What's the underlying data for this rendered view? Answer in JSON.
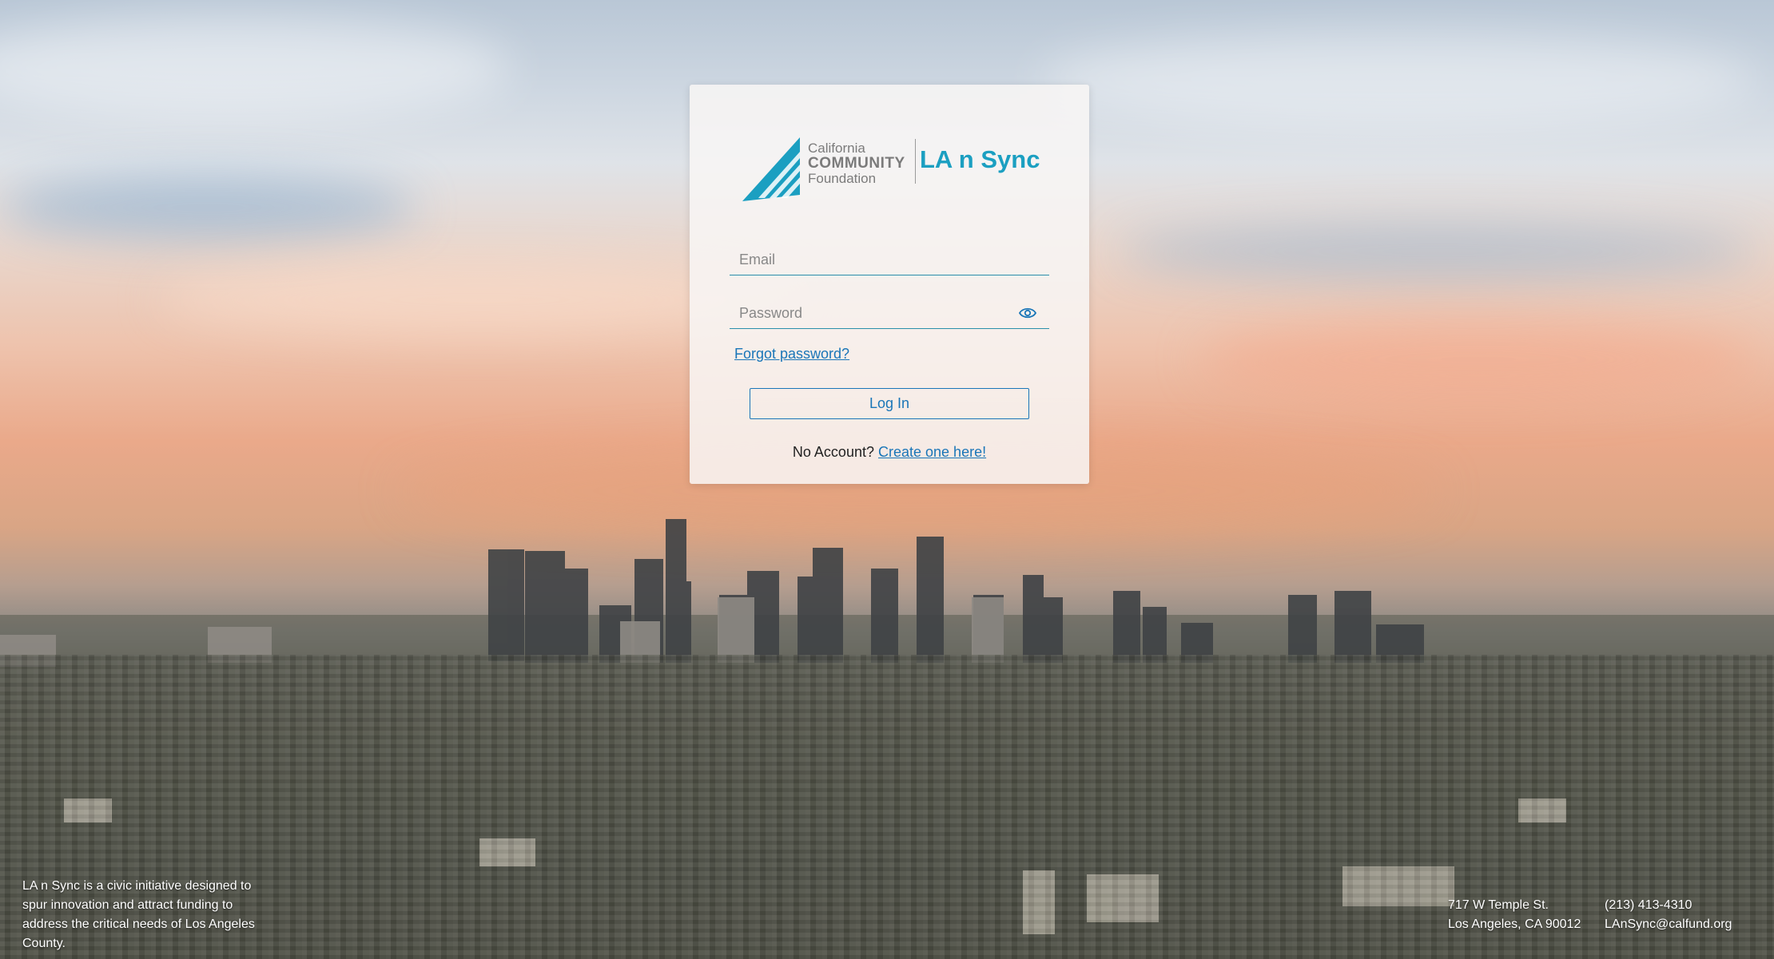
{
  "logo": {
    "org_line1": "California",
    "org_line2": "COMMUNITY",
    "org_line3": "Foundation",
    "product_name": "LA n Sync"
  },
  "login_form": {
    "email_placeholder": "Email",
    "email_value": "",
    "password_placeholder": "Password",
    "password_value": "",
    "forgot_password_label": "Forgot password?",
    "login_button_label": "Log In",
    "no_account_text": "No Account?",
    "create_account_link": "Create one here!"
  },
  "footer": {
    "description": "LA n Sync is a civic initiative designed to spur innovation and attract funding to address the critical needs of Los Angeles County.",
    "address_line1": "717 W Temple St.",
    "address_line2": "Los Angeles, CA 90012",
    "phone": "(213) 413-4310",
    "email": "LAnSync@calfund.org"
  },
  "colors": {
    "brand_teal": "#1b9fc1",
    "link_blue": "#1a76b8",
    "field_underline": "#2a8fab"
  },
  "icons": {
    "password_toggle": "eye-icon",
    "logo_mark": "ccf-logo-icon"
  }
}
